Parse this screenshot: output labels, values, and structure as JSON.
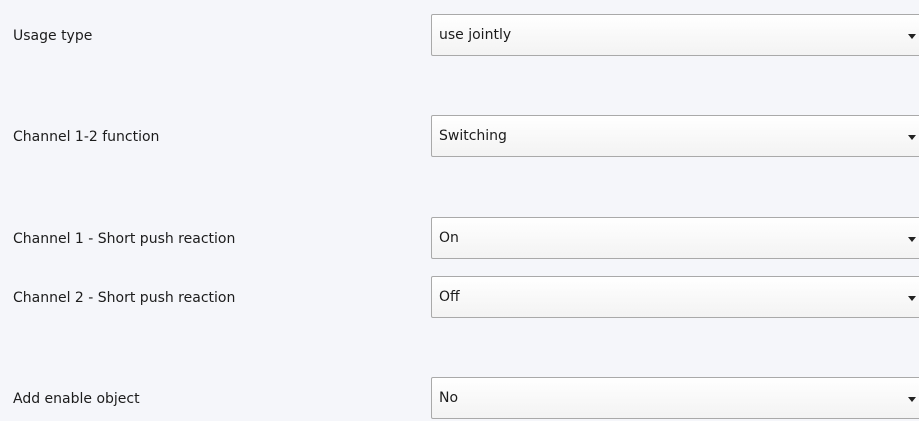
{
  "settings": {
    "rows": [
      {
        "label": "Usage type",
        "value": "use jointly"
      },
      {
        "label": "Channel 1-2 function",
        "value": "Switching"
      },
      {
        "label": "Channel 1 - Short push reaction",
        "value": "On"
      },
      {
        "label": "Channel 2 - Short push reaction",
        "value": "Off"
      },
      {
        "label": "Add enable object",
        "value": "No"
      }
    ]
  },
  "icons": {
    "dropdown": "chevron-down-icon"
  },
  "colors": {
    "panel_background": "#f5f6fa",
    "select_border": "#a9a9a9",
    "text": "#1c1c1c"
  }
}
